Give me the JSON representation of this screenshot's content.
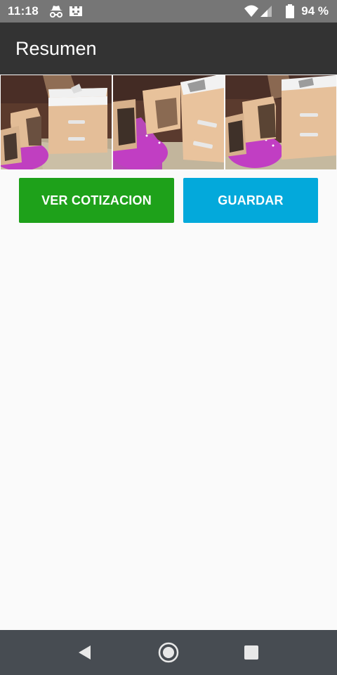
{
  "status_bar": {
    "time": "11:18",
    "battery_percent": "94 %",
    "icons": [
      "incognito-icon",
      "notification-icon",
      "wifi-icon",
      "cell-signal-icon",
      "battery-icon"
    ],
    "battery_level": 0.94
  },
  "app_bar": {
    "title": "Resumen"
  },
  "gallery": {
    "images": [
      "furniture-render-image",
      "furniture-render-image",
      "furniture-render-image"
    ]
  },
  "actions": {
    "quote_label": "VER COTIZACION",
    "save_label": "GUARDAR"
  },
  "colors": {
    "status_bar": "#767676",
    "app_bar": "#333333",
    "background": "#fafafa",
    "quote_button": "#1ea11a",
    "save_button": "#03a9db",
    "nav_bar": "#474c52"
  },
  "nav_bar": {
    "icons": [
      "back-icon",
      "home-icon",
      "recents-icon"
    ]
  }
}
